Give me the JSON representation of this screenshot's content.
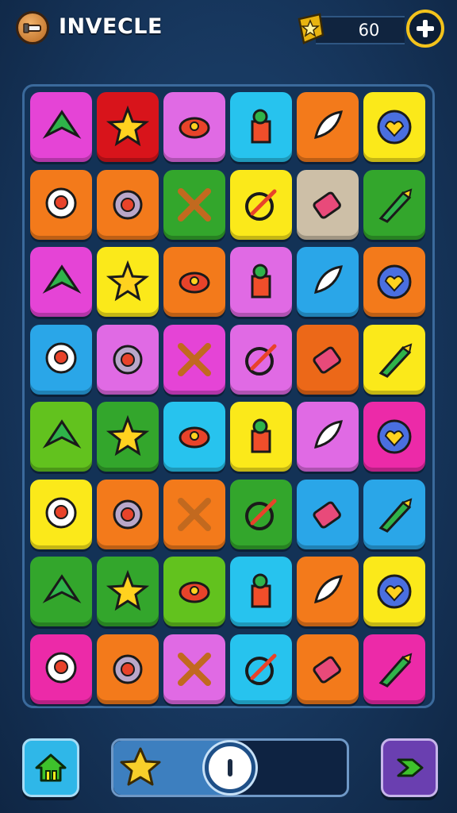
{
  "header": {
    "title": "INVECLE",
    "coins": "60",
    "logo_icon": "tool-logo-icon",
    "coin_icon": "gold-star-coin-icon",
    "add_icon": "plus-icon"
  },
  "colors": {
    "magenta": "#e544d6",
    "red": "#d8141b",
    "pink": "#e06ae4",
    "cyan": "#27c3ee",
    "orange": "#f37a1b",
    "yellow": "#fbe91a",
    "green": "#33a62c",
    "lime": "#62c21e",
    "beige": "#cdbfa7",
    "hotpink": "#ec2aa8",
    "blue": "#2aa6e8",
    "darkorange": "#ec6818"
  },
  "board": {
    "rows": [
      [
        {
          "color": "magenta",
          "icon": "green-arrow-icon"
        },
        {
          "color": "red",
          "icon": "yellow-star-icon"
        },
        {
          "color": "pink",
          "icon": "red-spaceship-icon"
        },
        {
          "color": "cyan",
          "icon": "robot-figure-icon"
        },
        {
          "color": "orange",
          "icon": "shell-icon"
        },
        {
          "color": "yellow",
          "icon": "heart-badge-icon"
        }
      ],
      [
        {
          "color": "orange",
          "icon": "speech-bubble-icon"
        },
        {
          "color": "orange",
          "icon": "sawblade-icon"
        },
        {
          "color": "green",
          "icon": "crossed-sticks-icon"
        },
        {
          "color": "yellow",
          "icon": "target-wrench-icon"
        },
        {
          "color": "beige",
          "icon": "battery-icon"
        },
        {
          "color": "green",
          "icon": "crayon-icon"
        }
      ],
      [
        {
          "color": "magenta",
          "icon": "calendar-icon"
        },
        {
          "color": "yellow",
          "icon": "bird-icon"
        },
        {
          "color": "orange",
          "icon": "house-icon"
        },
        {
          "color": "pink",
          "icon": "cone-icon"
        },
        {
          "color": "blue",
          "icon": "no-sign-icon"
        },
        {
          "color": "orange",
          "icon": "lamp-icon"
        }
      ],
      [
        {
          "color": "blue",
          "icon": "donut-icon"
        },
        {
          "color": "pink",
          "icon": "wrench-icon"
        },
        {
          "color": "magenta",
          "icon": "triangle-ruler-icon"
        },
        {
          "color": "pink",
          "icon": "strawberry-icon"
        },
        {
          "color": "darkorange",
          "icon": "blob-icon"
        },
        {
          "color": "yellow",
          "icon": "smiley-icon"
        }
      ],
      [
        {
          "color": "lime",
          "icon": "cannon-icon"
        },
        {
          "color": "green",
          "icon": "fence-icon"
        },
        {
          "color": "cyan",
          "icon": "rocket-icon"
        },
        {
          "color": "yellow",
          "icon": "key-icon"
        },
        {
          "color": "pink",
          "icon": "boot-icon"
        },
        {
          "color": "hotpink",
          "icon": "heart-icon"
        }
      ],
      [
        {
          "color": "yellow",
          "icon": "gingerbread-icon"
        },
        {
          "color": "orange",
          "icon": "picture-card-icon"
        },
        {
          "color": "orange",
          "icon": "box-knife-icon"
        },
        {
          "color": "green",
          "icon": "ring-icon"
        },
        {
          "color": "blue",
          "icon": "gear-icon"
        },
        {
          "color": "blue",
          "icon": "sun-face-icon"
        }
      ],
      [
        {
          "color": "green",
          "icon": "face-bubble-icon"
        },
        {
          "color": "green",
          "icon": "sad-face-icon"
        },
        {
          "color": "lime",
          "icon": "cookie-face-icon"
        },
        {
          "color": "cyan",
          "icon": "cog-icon"
        },
        {
          "color": "orange",
          "icon": "hammer-icon"
        },
        {
          "color": "yellow",
          "icon": "smile-face-icon"
        }
      ],
      [
        {
          "color": "hotpink",
          "icon": "pliers-icon"
        },
        {
          "color": "orange",
          "icon": "battery-pack-icon"
        },
        {
          "color": "pink",
          "icon": "flower-gear-icon"
        },
        {
          "color": "cyan",
          "icon": "fish-bubble-icon"
        },
        {
          "color": "orange",
          "icon": "cross-swords-icon"
        },
        {
          "color": "hotpink",
          "icon": "padlock-icon"
        }
      ]
    ]
  },
  "footer": {
    "home_icon": "home-icon",
    "star_icon": "star-icon",
    "knob_icon": "power-knob-icon",
    "next_icon": "chevron-right-icon",
    "progress": 0.5
  }
}
